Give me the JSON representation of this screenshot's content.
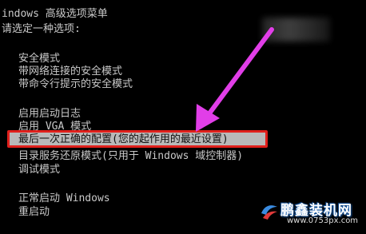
{
  "header": {
    "title": "indows 高级选项菜单",
    "prompt": "请选定一种选项:"
  },
  "menu": {
    "group1": [
      "安全模式",
      "带网络连接的安全模式",
      "带命令行提示的安全模式"
    ],
    "group2": [
      "启用启动日志",
      "启用 VGA 模式"
    ],
    "selected": "最后一次正确的配置(您的起作用的最近设置)",
    "group3": [
      "目录服务还原模式(只用于 Windows 域控制器)",
      "调试模式"
    ],
    "group4": [
      "正常启动 Windows",
      "重启动"
    ]
  },
  "annotation": {
    "arrow_color": "#e13ee8",
    "box_color": "#e0201c"
  },
  "watermark": {
    "brand": "鹏鑫装机网",
    "url": "www.0753px.com"
  }
}
